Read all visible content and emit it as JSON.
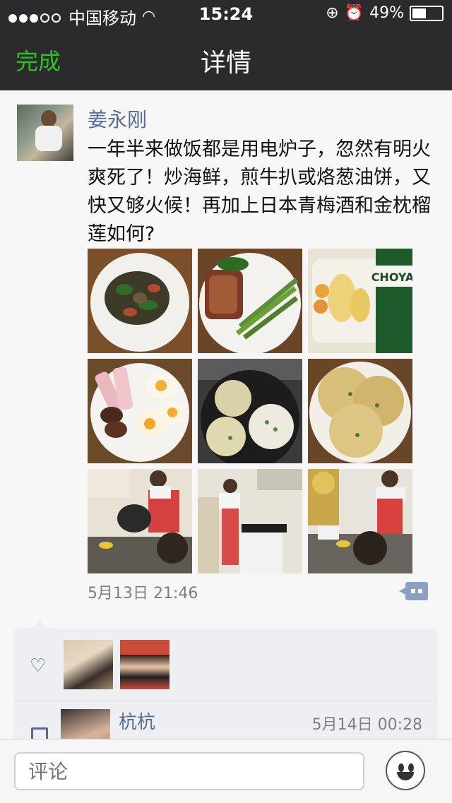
{
  "status": {
    "carrier": "中国移动",
    "time": "15:24",
    "battery": "49%",
    "battery_level": 0.49
  },
  "nav": {
    "done_label": "完成",
    "title": "详情"
  },
  "post": {
    "author": "姜永刚",
    "text": "一年半来做饭都是用电炉子，忽然有明火爽死了！炒海鲜，煎牛扒或烙葱油饼，又快又够火候！再加上日本青梅酒和金枕榴莲如何?",
    "photos": [
      {
        "name": "seafood-stirfry"
      },
      {
        "name": "steak-asparagus"
      },
      {
        "name": "durian-choya",
        "label": "CHOYA"
      },
      {
        "name": "ham-eggs"
      },
      {
        "name": "scallion-pancake-pan"
      },
      {
        "name": "scallion-pancakes-plate"
      },
      {
        "name": "cooking-photo-1"
      },
      {
        "name": "cooking-photo-2"
      },
      {
        "name": "cooking-photo-3"
      }
    ],
    "timestamp": "5月13日 21:46"
  },
  "comment": {
    "author": "杭杭",
    "time": "5月14日 00:28"
  },
  "input": {
    "placeholder": "评论"
  },
  "colors": {
    "nav_bg": "#2b2b2e",
    "done": "#2fbf25",
    "author_link": "#566c97"
  }
}
